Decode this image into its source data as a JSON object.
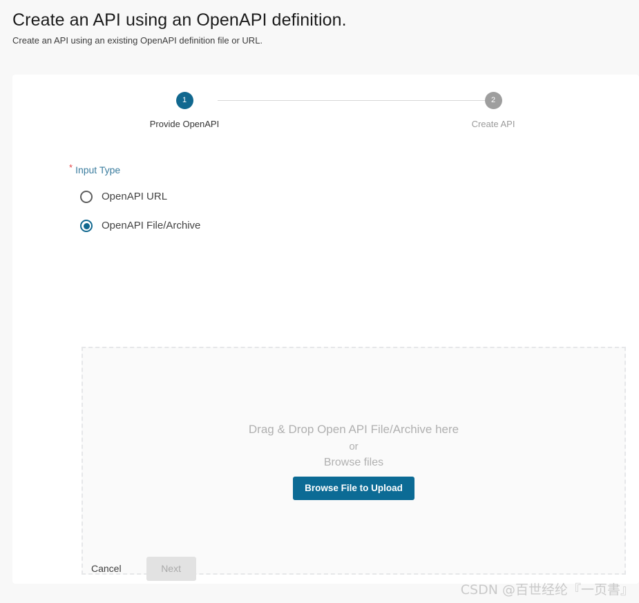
{
  "header": {
    "title": "Create an API using an OpenAPI definition.",
    "subtitle": "Create an API using an existing OpenAPI definition file or URL."
  },
  "stepper": {
    "steps": [
      {
        "number": "1",
        "label": "Provide OpenAPI",
        "state": "active"
      },
      {
        "number": "2",
        "label": "Create API",
        "state": "inactive"
      }
    ]
  },
  "form": {
    "input_type": {
      "required_marker": "*",
      "label": "Input Type",
      "options": [
        {
          "label": "OpenAPI URL",
          "selected": false
        },
        {
          "label": "OpenAPI File/Archive",
          "selected": true
        }
      ]
    }
  },
  "dropzone": {
    "line1": "Drag & Drop Open API File/Archive here",
    "line2": "or",
    "line3": "Browse files",
    "button_label": "Browse File to Upload"
  },
  "footer": {
    "cancel_label": "Cancel",
    "next_label": "Next"
  },
  "watermark": {
    "text": "CSDN @百世经纶『一页書』"
  },
  "colors": {
    "accent": "#0c6b95",
    "step_active": "#11688f",
    "step_inactive": "#9e9e9e",
    "required_star": "#e4484b",
    "field_label": "#3a7c9e",
    "page_background": "#f8f8f8",
    "card_background": "#ffffff",
    "dropzone_background": "#fafafa",
    "disabled_button": "#e2e2e2"
  }
}
